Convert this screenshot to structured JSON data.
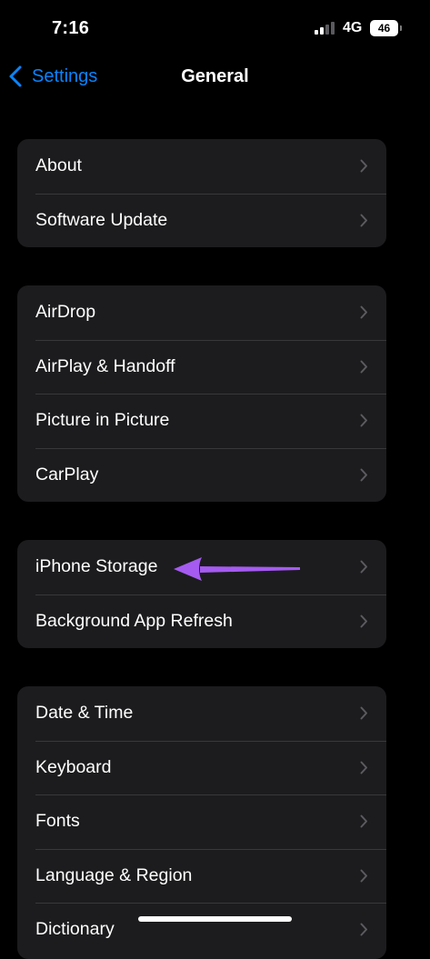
{
  "status_bar": {
    "time": "7:16",
    "network": "4G",
    "battery": "46"
  },
  "nav": {
    "back_label": "Settings",
    "title": "General"
  },
  "groups": [
    {
      "items": [
        {
          "label": "About"
        },
        {
          "label": "Software Update"
        }
      ]
    },
    {
      "items": [
        {
          "label": "AirDrop"
        },
        {
          "label": "AirPlay & Handoff"
        },
        {
          "label": "Picture in Picture"
        },
        {
          "label": "CarPlay"
        }
      ]
    },
    {
      "items": [
        {
          "label": "iPhone Storage"
        },
        {
          "label": "Background App Refresh"
        }
      ]
    },
    {
      "items": [
        {
          "label": "Date & Time"
        },
        {
          "label": "Keyboard"
        },
        {
          "label": "Fonts"
        },
        {
          "label": "Language & Region"
        },
        {
          "label": "Dictionary"
        }
      ]
    }
  ],
  "icons": {
    "back": "chevron-left-icon",
    "row_disclosure": "chevron-right-icon",
    "annotation": "arrow-left-icon",
    "signal": "signal-bars-icon",
    "battery": "battery-icon"
  },
  "colors": {
    "background": "#000000",
    "cell": "#1c1c1e",
    "separator": "#38383a",
    "accent": "#0a84ff",
    "chevron": "#5b5b60",
    "annotation_arrow": "#a55bf0"
  }
}
